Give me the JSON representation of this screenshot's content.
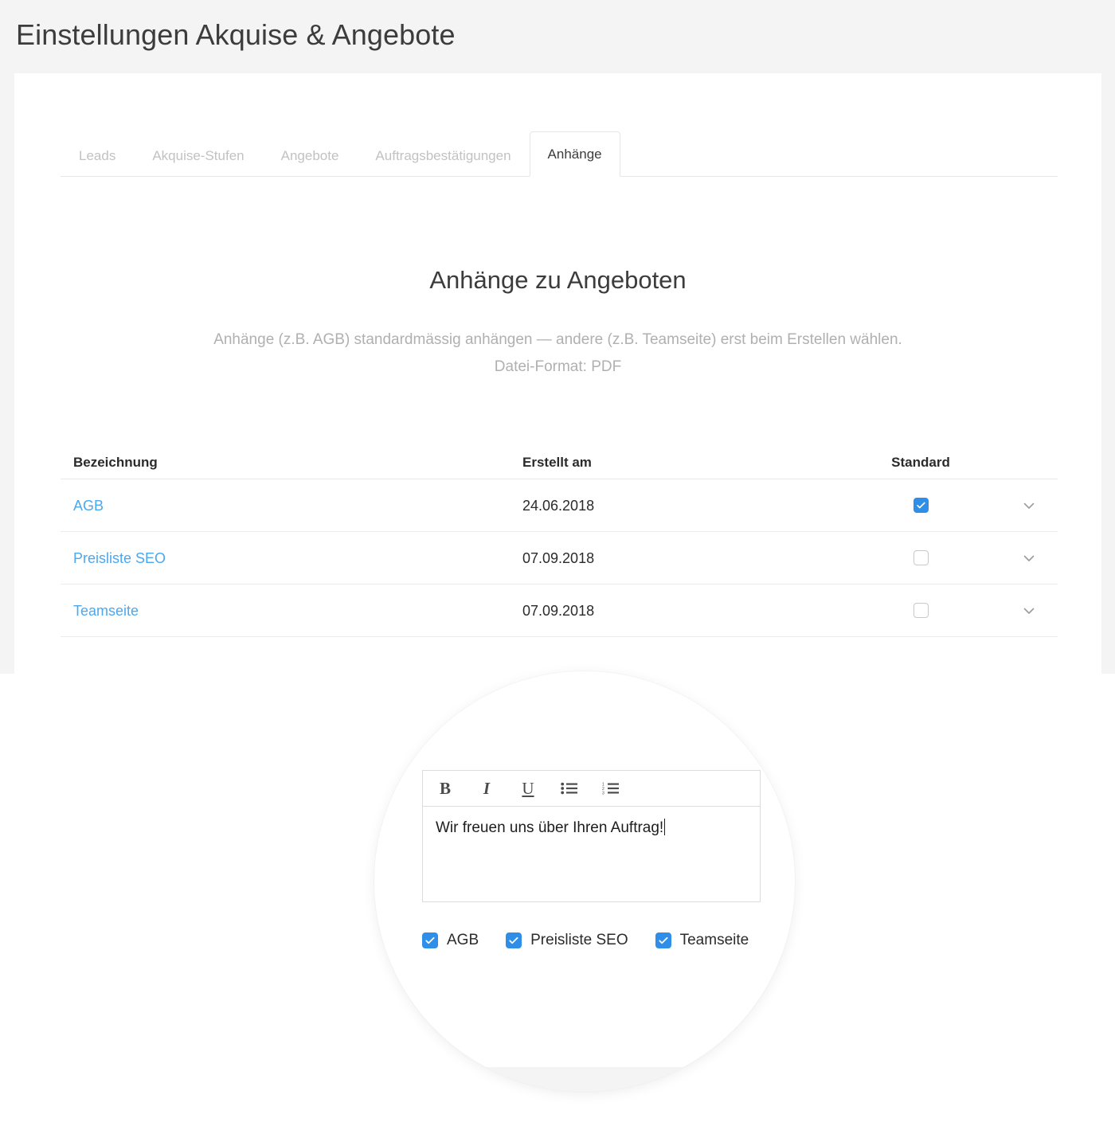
{
  "page": {
    "title": "Einstellungen Akquise & Angebote"
  },
  "tabs": [
    {
      "label": "Leads",
      "active": false,
      "name": "tab-leads"
    },
    {
      "label": "Akquise-Stufen",
      "active": false,
      "name": "tab-akquise-stufen"
    },
    {
      "label": "Angebote",
      "active": false,
      "name": "tab-angebote"
    },
    {
      "label": "Auftragsbestätigungen",
      "active": false,
      "name": "tab-auftragsbestaetigungen"
    },
    {
      "label": "Anhänge",
      "active": true,
      "name": "tab-anhaenge"
    }
  ],
  "section": {
    "heading": "Anhänge zu Angeboten",
    "description_line1": "Anhänge (z.B. AGB) standardmässig anhängen — andere (z.B. Teamseite) erst beim Erstellen wählen.",
    "description_line2": "Datei-Format: PDF"
  },
  "table": {
    "columns": {
      "name": "Bezeichnung",
      "created": "Erstellt am",
      "standard": "Standard"
    },
    "rows": [
      {
        "name": "AGB",
        "created": "24.06.2018",
        "standard": true,
        "chevron": "chevron-down-icon"
      },
      {
        "name": "Preisliste SEO",
        "created": "07.09.2018",
        "standard": false,
        "chevron": "chevron-down-icon"
      },
      {
        "name": "Teamseite",
        "created": "07.09.2018",
        "standard": false,
        "chevron": "chevron-down-icon"
      }
    ]
  },
  "magnifier": {
    "editor": {
      "toolbar": [
        {
          "glyph": "B",
          "name": "bold-icon",
          "title": "Bold"
        },
        {
          "glyph": "I",
          "name": "italic-icon",
          "title": "Italic"
        },
        {
          "glyph": "U",
          "name": "underline-icon",
          "title": "Underline"
        },
        {
          "glyph": "",
          "name": "bullet-list-icon",
          "title": "Unordered list"
        },
        {
          "glyph": "",
          "name": "numbered-list-icon",
          "title": "Ordered list"
        }
      ],
      "content": "Wir freuen uns über Ihren Auftrag!",
      "placeholder": ""
    },
    "attachments": [
      {
        "label": "AGB",
        "checked": true
      },
      {
        "label": "Preisliste SEO",
        "checked": true
      },
      {
        "label": "Teamseite",
        "checked": true
      }
    ]
  },
  "colors": {
    "accent": "#2f8fe8",
    "link": "#4aa8f0",
    "page_background": "#f4f4f4",
    "card_background": "#ffffff",
    "text": "#2b2b2b",
    "muted": "#b0b0b0"
  }
}
